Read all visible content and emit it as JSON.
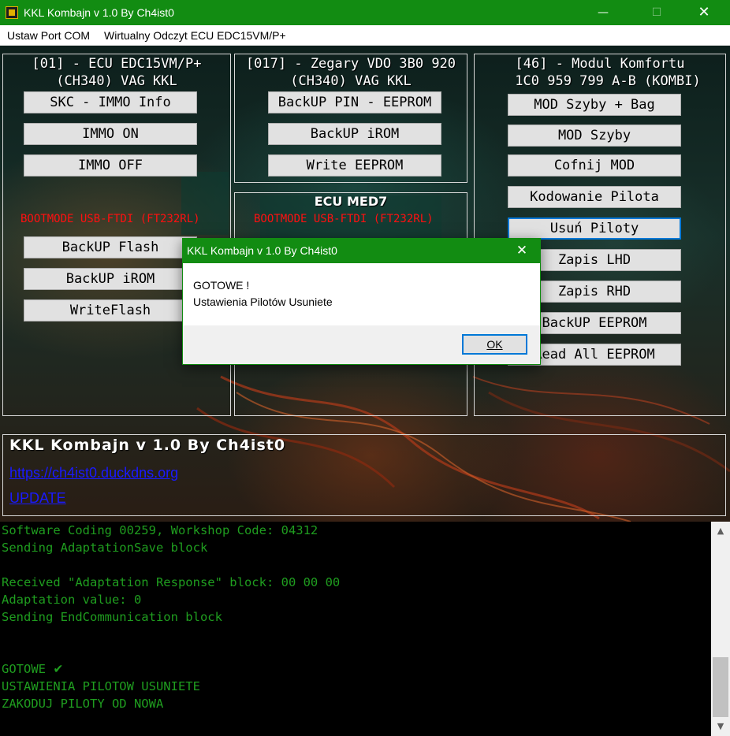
{
  "window": {
    "title": "KKL Kombajn v 1.0 By Ch4ist0",
    "min_glyph": "—",
    "max_glyph": "☐",
    "close_glyph": "✕"
  },
  "menu": {
    "items": [
      "Ustaw Port COM",
      "Wirtualny Odczyt ECU EDC15VM/P+"
    ]
  },
  "panel_ecu": {
    "title_line1": "[01] - ECU EDC15VM/P+",
    "title_line2": "(CH340) VAG KKL",
    "buttons": [
      "SKC - IMMO Info",
      "IMMO ON",
      "IMMO OFF"
    ],
    "bootmode_label": "BOOTMODE USB-FTDI (FT232RL)",
    "buttons2": [
      "BackUP Flash",
      "BackUP iROM",
      "WriteFlash"
    ]
  },
  "panel_zegary": {
    "title_line1": "[017] - Zegary VDO 3B0 920",
    "title_line2": "(CH340) VAG KKL",
    "buttons": [
      "BackUP PIN - EEPROM",
      "BackUP iROM",
      "Write EEPROM"
    ]
  },
  "panel_med7": {
    "title": "ECU MED7",
    "bootmode_label": "BOOTMODE USB-FTDI (FT232RL)"
  },
  "panel_komfort": {
    "title_line1": "[46] - Modul Komfortu",
    "title_line2": "1C0 959 799 A-B (KOMBI)",
    "buttons": [
      "MOD Szyby + Bag",
      "MOD Szyby",
      "Cofnij MOD",
      "Kodowanie Pilota",
      "Usuń Piloty",
      "Zapis LHD",
      "Zapis RHD",
      "BackUP EEPROM",
      "Read All EEPROM"
    ]
  },
  "info": {
    "title": "KKL Kombajn v 1.0 By Ch4ist0",
    "site_link": "https://ch4ist0.duckdns.org",
    "update_link": "UPDATE"
  },
  "console": {
    "lines": [
      "Software Coding 00259, Workshop Code: 04312",
      "Sending AdaptationSave block",
      "",
      "Received \"Adaptation Response\" block: 00 00 00",
      "Adaptation value: 0",
      "Sending EndCommunication block",
      "",
      "",
      "GOTOWE",
      "USTAWIENIA PILOTOW USUNIETE",
      "ZAKODUJ PILOTY OD NOWA"
    ],
    "check_glyph": "✔",
    "scroll_up": "▲",
    "scroll_down": "▼"
  },
  "dialog": {
    "title": "KKL Kombajn v 1.0 By Ch4ist0",
    "close_glyph": "✕",
    "message_line1": "GOTOWE !",
    "message_line2": "Ustawienia Pilotów Usuniete",
    "ok_label": "OK"
  },
  "colors": {
    "titlebar": "#128c12",
    "console_text": "#1f9d1f",
    "bootmode_red": "#ff1010",
    "focus_blue": "#0078d7",
    "link_blue": "#1a1aff"
  }
}
